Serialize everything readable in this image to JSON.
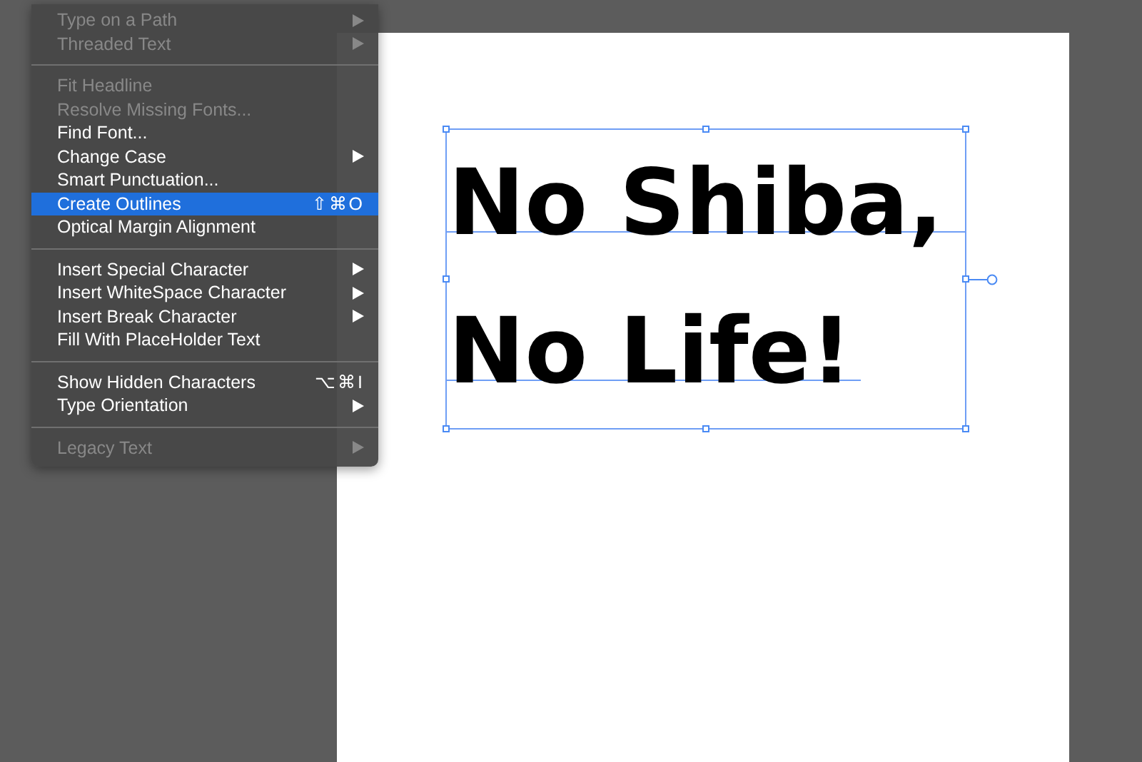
{
  "menu": {
    "groups": [
      {
        "items": [
          {
            "label": "Type on a Path",
            "disabled": true,
            "submenu": true,
            "selected": false
          },
          {
            "label": "Threaded Text",
            "disabled": true,
            "submenu": true,
            "selected": false
          }
        ]
      },
      {
        "items": [
          {
            "label": "Fit Headline",
            "disabled": true,
            "submenu": false,
            "selected": false
          },
          {
            "label": "Resolve Missing Fonts...",
            "disabled": true,
            "submenu": false,
            "selected": false
          },
          {
            "label": "Find Font...",
            "disabled": false,
            "submenu": false,
            "selected": false
          },
          {
            "label": "Change Case",
            "disabled": false,
            "submenu": true,
            "selected": false
          },
          {
            "label": "Smart Punctuation...",
            "disabled": false,
            "submenu": false,
            "selected": false
          },
          {
            "label": "Create Outlines",
            "disabled": false,
            "submenu": false,
            "selected": true,
            "shortcut": "⇧⌘O"
          },
          {
            "label": "Optical Margin Alignment",
            "disabled": false,
            "submenu": false,
            "selected": false
          }
        ]
      },
      {
        "items": [
          {
            "label": "Insert Special Character",
            "disabled": false,
            "submenu": true,
            "selected": false
          },
          {
            "label": "Insert WhiteSpace Character",
            "disabled": false,
            "submenu": true,
            "selected": false
          },
          {
            "label": "Insert Break Character",
            "disabled": false,
            "submenu": true,
            "selected": false
          },
          {
            "label": "Fill With PlaceHolder Text",
            "disabled": false,
            "submenu": false,
            "selected": false
          }
        ]
      },
      {
        "items": [
          {
            "label": "Show Hidden Characters",
            "disabled": false,
            "submenu": false,
            "selected": false,
            "shortcut": "⌥⌘I"
          },
          {
            "label": "Type Orientation",
            "disabled": false,
            "submenu": true,
            "selected": false
          }
        ]
      },
      {
        "items": [
          {
            "label": "Legacy Text",
            "disabled": true,
            "submenu": true,
            "selected": false
          }
        ]
      }
    ]
  },
  "artboard": {
    "text_lines": [
      "No Shiba,",
      "No Life!"
    ]
  }
}
